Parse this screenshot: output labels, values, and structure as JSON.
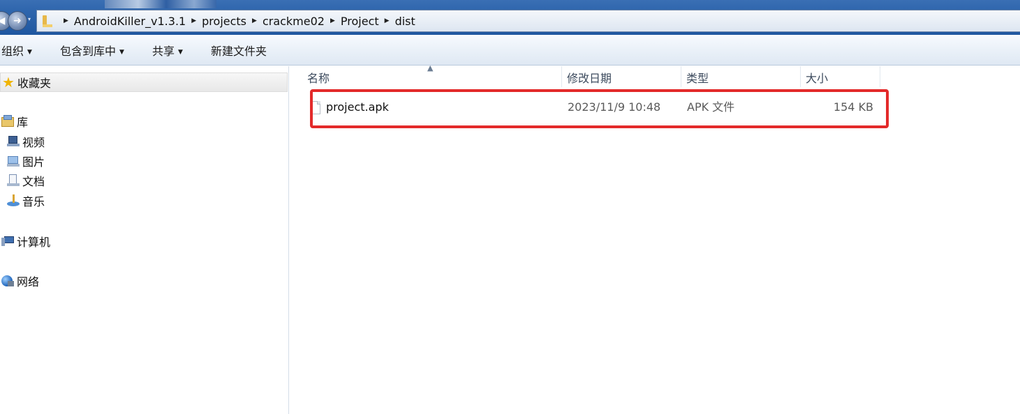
{
  "address_bar": {
    "crumbs": [
      "AndroidKiller_v1.3.1",
      "projects",
      "crackme02",
      "Project",
      "dist"
    ]
  },
  "toolbar": {
    "organize_label": "组织",
    "include_library_label": "包含到库中",
    "share_label": "共享",
    "new_folder_label": "新建文件夹"
  },
  "navigation": {
    "favorites_label": "收藏夹",
    "libraries_label": "库",
    "library_items": [
      {
        "label": "视频",
        "icon": "video-library-icon"
      },
      {
        "label": "图片",
        "icon": "pictures-library-icon"
      },
      {
        "label": "文档",
        "icon": "documents-library-icon"
      },
      {
        "label": "音乐",
        "icon": "music-library-icon"
      }
    ],
    "computer_label": "计算机",
    "network_label": "网络"
  },
  "file_list": {
    "columns": {
      "name": "名称",
      "modified": "修改日期",
      "type": "类型",
      "size": "大小"
    },
    "rows": [
      {
        "name": "project.apk",
        "modified": "2023/11/9 10:48",
        "type": "APK 文件",
        "size": "154 KB",
        "highlighted": true
      }
    ]
  },
  "colors": {
    "highlight_border": "#e32a2a",
    "titlebar": "#2f66ad"
  }
}
